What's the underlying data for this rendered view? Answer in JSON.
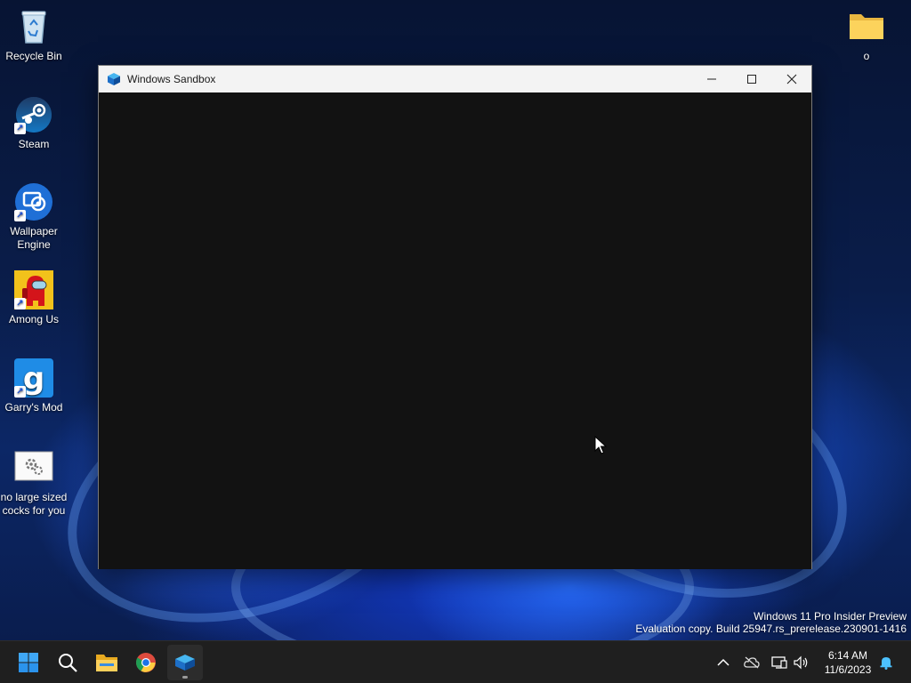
{
  "desktop": {
    "icons": [
      {
        "label": "Recycle Bin",
        "icon": "recycle-bin-icon"
      },
      {
        "label": "Steam",
        "icon": "steam-icon"
      },
      {
        "label": "Wallpaper Engine",
        "icon": "wallpaper-engine-icon"
      },
      {
        "label": "Among Us",
        "icon": "among-us-icon"
      },
      {
        "label": "Garry's Mod",
        "icon": "garrys-mod-icon"
      },
      {
        "label": "no large sized cocks for you",
        "icon": "settings-file-icon"
      },
      {
        "label": "o",
        "icon": "folder-icon"
      }
    ]
  },
  "window": {
    "title": "Windows Sandbox",
    "icon": "windows-sandbox-icon",
    "content_color": "#121212"
  },
  "watermark": {
    "line1": "Windows 11 Pro Insider Preview",
    "line2": "Evaluation copy. Build 25947.rs_prerelease.230901-1416"
  },
  "taskbar": {
    "apps": [
      {
        "name": "start",
        "icon": "windows-start-icon"
      },
      {
        "name": "search",
        "icon": "search-icon"
      },
      {
        "name": "file-explorer",
        "icon": "file-explorer-icon"
      },
      {
        "name": "chrome",
        "icon": "chrome-icon"
      },
      {
        "name": "windows-sandbox",
        "icon": "windows-sandbox-icon",
        "running": true
      }
    ],
    "tray": [
      "chevron-up-icon",
      "cloud-offline-icon",
      "network-icon",
      "volume-icon",
      "notification-bell-icon"
    ],
    "clock": {
      "time": "6:14 AM",
      "date": "11/6/2023"
    }
  },
  "colors": {
    "accent": "#0078d4",
    "taskbar": "#1f1f1f",
    "titlebar": "#f3f3f3"
  }
}
